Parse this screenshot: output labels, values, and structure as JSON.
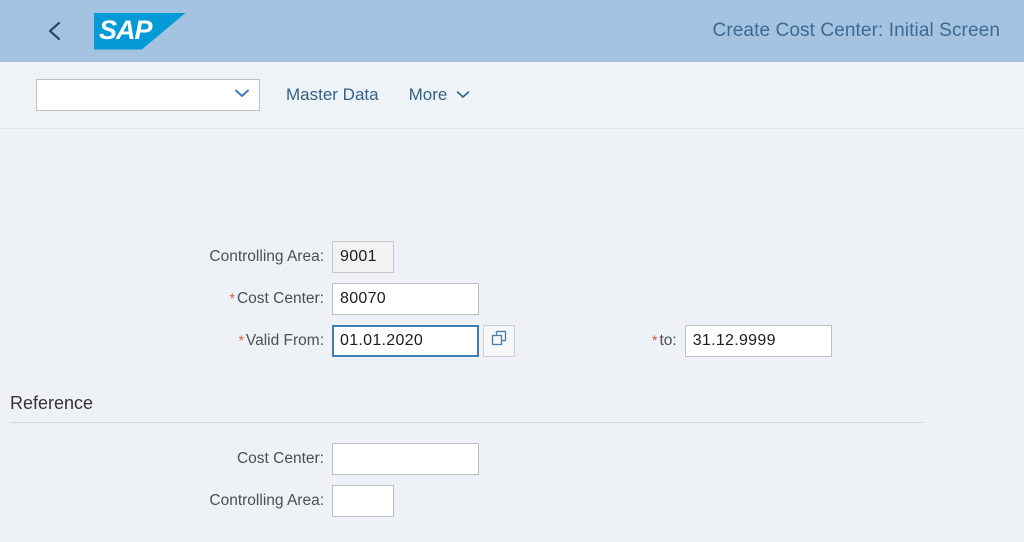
{
  "header": {
    "back_icon": "chevron-left-icon",
    "logo_text": "SAP",
    "title": "Create Cost Center: Initial Screen",
    "bg_color": "#a3c3e0",
    "title_color": "#3d6a92",
    "logo_color": "#049ad8"
  },
  "toolbar": {
    "variant_value": "",
    "variant_placeholder": "",
    "dropdown_icon": "chevron-down-icon",
    "master_data_label": "Master Data",
    "more_label": "More",
    "more_icon": "chevron-down-icon",
    "link_color": "#346187"
  },
  "form": {
    "controlling_area": {
      "label": "Controlling Area:",
      "value": "9001",
      "required": false,
      "readonly": true
    },
    "cost_center": {
      "label": "Cost Center:",
      "value": "80070",
      "required": true,
      "required_marker": "*"
    },
    "valid_from": {
      "label": "Valid From:",
      "value": "01.01.2020",
      "required": true,
      "required_marker": "*",
      "focused": true,
      "value_help_icon": "value-help-icon"
    },
    "valid_to": {
      "label": "to:",
      "value": "31.12.9999",
      "required": true,
      "required_marker": "*"
    }
  },
  "reference": {
    "section_title": "Reference",
    "cost_center": {
      "label": "Cost Center:",
      "value": "",
      "placeholder": ""
    },
    "controlling_area": {
      "label": "Controlling Area:",
      "value": "",
      "placeholder": ""
    }
  },
  "colors": {
    "required_star": "#e0563f",
    "focus_border": "#3f7fb5",
    "page_bg": "#eef2f7"
  }
}
